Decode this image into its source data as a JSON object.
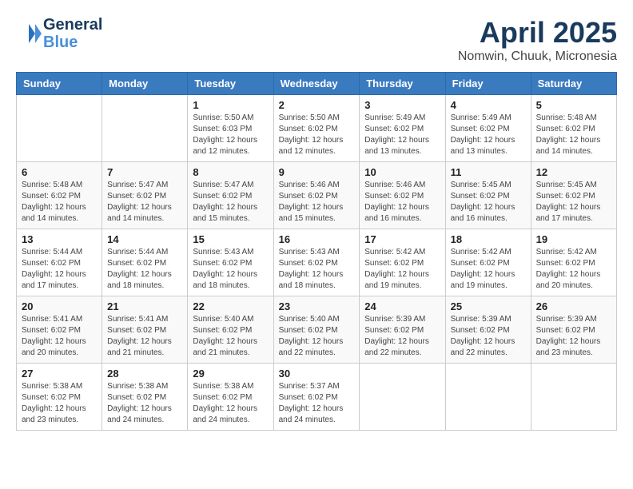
{
  "header": {
    "logo_line1": "General",
    "logo_line2": "Blue",
    "month": "April 2025",
    "location": "Nomwin, Chuuk, Micronesia"
  },
  "weekdays": [
    "Sunday",
    "Monday",
    "Tuesday",
    "Wednesday",
    "Thursday",
    "Friday",
    "Saturday"
  ],
  "weeks": [
    [
      {
        "day": "",
        "info": ""
      },
      {
        "day": "",
        "info": ""
      },
      {
        "day": "1",
        "info": "Sunrise: 5:50 AM\nSunset: 6:03 PM\nDaylight: 12 hours and 12 minutes."
      },
      {
        "day": "2",
        "info": "Sunrise: 5:50 AM\nSunset: 6:02 PM\nDaylight: 12 hours and 12 minutes."
      },
      {
        "day": "3",
        "info": "Sunrise: 5:49 AM\nSunset: 6:02 PM\nDaylight: 12 hours and 13 minutes."
      },
      {
        "day": "4",
        "info": "Sunrise: 5:49 AM\nSunset: 6:02 PM\nDaylight: 12 hours and 13 minutes."
      },
      {
        "day": "5",
        "info": "Sunrise: 5:48 AM\nSunset: 6:02 PM\nDaylight: 12 hours and 14 minutes."
      }
    ],
    [
      {
        "day": "6",
        "info": "Sunrise: 5:48 AM\nSunset: 6:02 PM\nDaylight: 12 hours and 14 minutes."
      },
      {
        "day": "7",
        "info": "Sunrise: 5:47 AM\nSunset: 6:02 PM\nDaylight: 12 hours and 14 minutes."
      },
      {
        "day": "8",
        "info": "Sunrise: 5:47 AM\nSunset: 6:02 PM\nDaylight: 12 hours and 15 minutes."
      },
      {
        "day": "9",
        "info": "Sunrise: 5:46 AM\nSunset: 6:02 PM\nDaylight: 12 hours and 15 minutes."
      },
      {
        "day": "10",
        "info": "Sunrise: 5:46 AM\nSunset: 6:02 PM\nDaylight: 12 hours and 16 minutes."
      },
      {
        "day": "11",
        "info": "Sunrise: 5:45 AM\nSunset: 6:02 PM\nDaylight: 12 hours and 16 minutes."
      },
      {
        "day": "12",
        "info": "Sunrise: 5:45 AM\nSunset: 6:02 PM\nDaylight: 12 hours and 17 minutes."
      }
    ],
    [
      {
        "day": "13",
        "info": "Sunrise: 5:44 AM\nSunset: 6:02 PM\nDaylight: 12 hours and 17 minutes."
      },
      {
        "day": "14",
        "info": "Sunrise: 5:44 AM\nSunset: 6:02 PM\nDaylight: 12 hours and 18 minutes."
      },
      {
        "day": "15",
        "info": "Sunrise: 5:43 AM\nSunset: 6:02 PM\nDaylight: 12 hours and 18 minutes."
      },
      {
        "day": "16",
        "info": "Sunrise: 5:43 AM\nSunset: 6:02 PM\nDaylight: 12 hours and 18 minutes."
      },
      {
        "day": "17",
        "info": "Sunrise: 5:42 AM\nSunset: 6:02 PM\nDaylight: 12 hours and 19 minutes."
      },
      {
        "day": "18",
        "info": "Sunrise: 5:42 AM\nSunset: 6:02 PM\nDaylight: 12 hours and 19 minutes."
      },
      {
        "day": "19",
        "info": "Sunrise: 5:42 AM\nSunset: 6:02 PM\nDaylight: 12 hours and 20 minutes."
      }
    ],
    [
      {
        "day": "20",
        "info": "Sunrise: 5:41 AM\nSunset: 6:02 PM\nDaylight: 12 hours and 20 minutes."
      },
      {
        "day": "21",
        "info": "Sunrise: 5:41 AM\nSunset: 6:02 PM\nDaylight: 12 hours and 21 minutes."
      },
      {
        "day": "22",
        "info": "Sunrise: 5:40 AM\nSunset: 6:02 PM\nDaylight: 12 hours and 21 minutes."
      },
      {
        "day": "23",
        "info": "Sunrise: 5:40 AM\nSunset: 6:02 PM\nDaylight: 12 hours and 22 minutes."
      },
      {
        "day": "24",
        "info": "Sunrise: 5:39 AM\nSunset: 6:02 PM\nDaylight: 12 hours and 22 minutes."
      },
      {
        "day": "25",
        "info": "Sunrise: 5:39 AM\nSunset: 6:02 PM\nDaylight: 12 hours and 22 minutes."
      },
      {
        "day": "26",
        "info": "Sunrise: 5:39 AM\nSunset: 6:02 PM\nDaylight: 12 hours and 23 minutes."
      }
    ],
    [
      {
        "day": "27",
        "info": "Sunrise: 5:38 AM\nSunset: 6:02 PM\nDaylight: 12 hours and 23 minutes."
      },
      {
        "day": "28",
        "info": "Sunrise: 5:38 AM\nSunset: 6:02 PM\nDaylight: 12 hours and 24 minutes."
      },
      {
        "day": "29",
        "info": "Sunrise: 5:38 AM\nSunset: 6:02 PM\nDaylight: 12 hours and 24 minutes."
      },
      {
        "day": "30",
        "info": "Sunrise: 5:37 AM\nSunset: 6:02 PM\nDaylight: 12 hours and 24 minutes."
      },
      {
        "day": "",
        "info": ""
      },
      {
        "day": "",
        "info": ""
      },
      {
        "day": "",
        "info": ""
      }
    ]
  ]
}
